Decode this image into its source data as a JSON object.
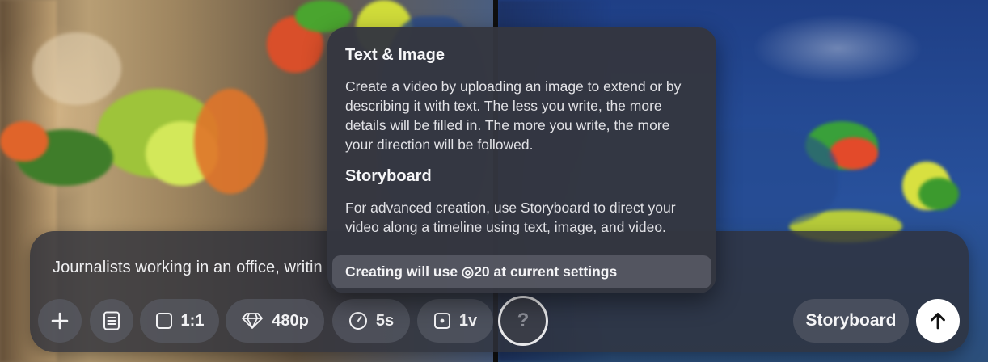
{
  "prompt": {
    "text": "Journalists working in an office, writin"
  },
  "toolbar": {
    "add_icon": "plus-icon",
    "presets_icon": "document-list-icon",
    "aspect_ratio": {
      "icon": "square-icon",
      "label": "1:1"
    },
    "resolution": {
      "icon": "diamond-icon",
      "label": "480p"
    },
    "duration": {
      "icon": "clock-icon",
      "label": "5s"
    },
    "variations": {
      "icon": "dice-icon",
      "label": "1v"
    },
    "help_label": "?",
    "storyboard_label": "Storyboard",
    "submit_icon": "arrow-up-icon"
  },
  "popover": {
    "section1_title": "Text & Image",
    "section1_body": "Create a video by uploading an image to extend or by describing it with text. The less you write, the more details will be filled in. The more you write, the more your direction will be followed.",
    "section2_title": "Storyboard",
    "section2_body": "For advanced creation, use Storyboard to direct your video along a timeline using text, image, and video.",
    "cost_text": "Creating will use ◎20 at current settings"
  },
  "colors": {
    "bar_bg": "#30323c",
    "chip_bg": "#5f626e",
    "submit_bg": "#ffffff",
    "text": "#f0f0f2"
  }
}
